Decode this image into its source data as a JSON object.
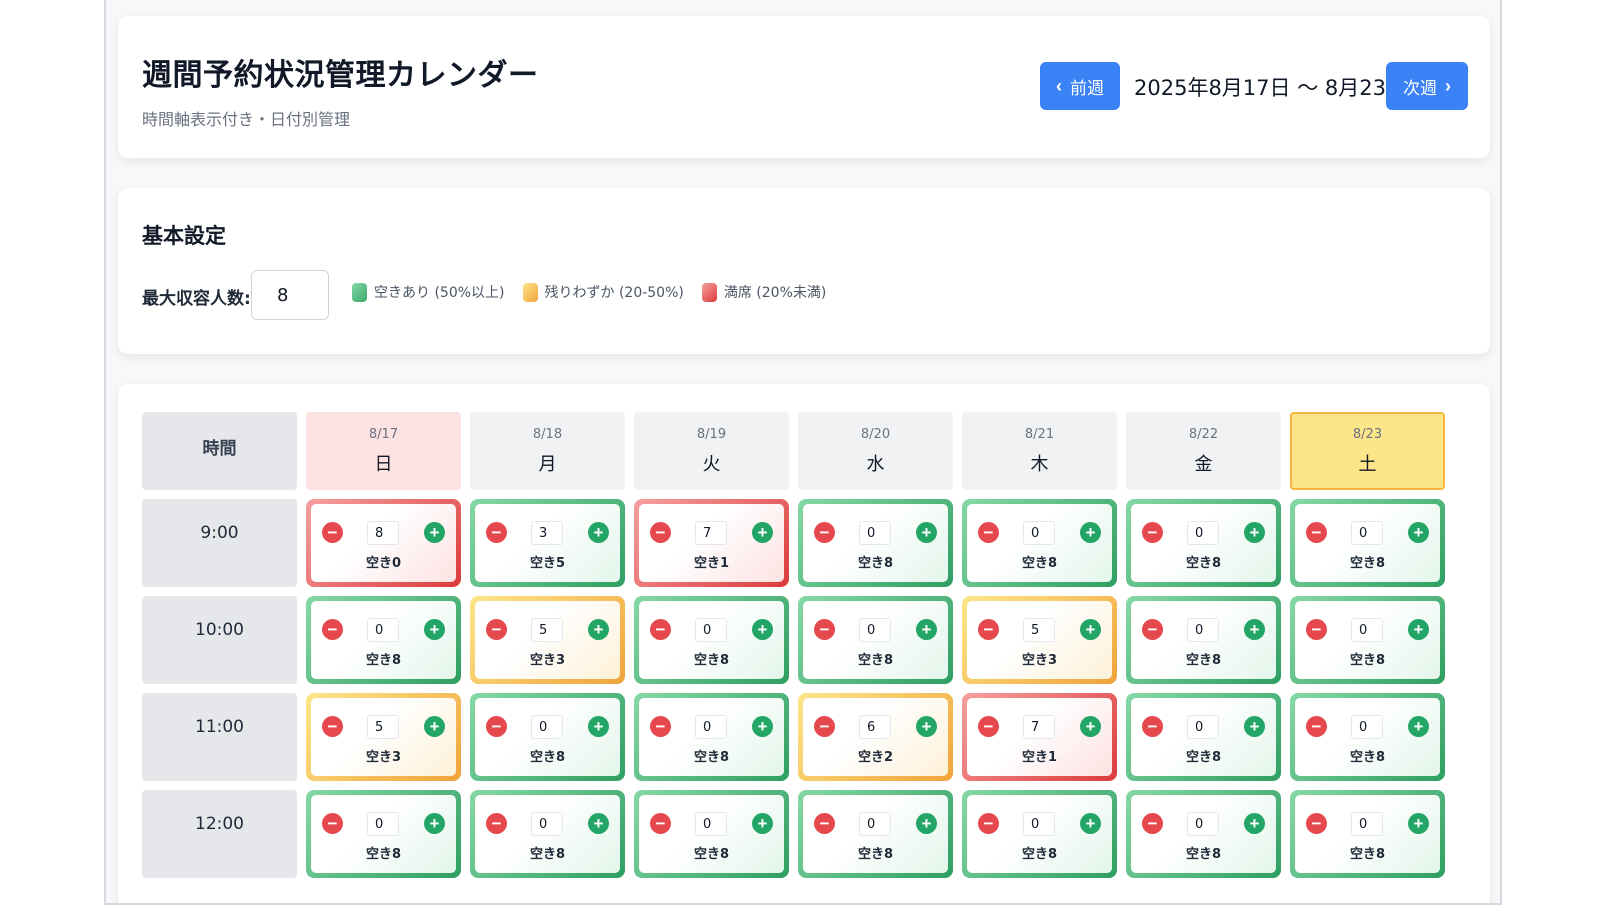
{
  "header": {
    "title": "週間予約状況管理カレンダー",
    "subtitle": "時間軸表示付き・日付別管理",
    "prev_label": "前週",
    "next_label": "次週",
    "week_range": "2025年8月17日 〜 8月23日"
  },
  "settings": {
    "title": "基本設定",
    "capacity_label": "最大収容人数:",
    "capacity_value": "8",
    "legend": [
      {
        "label": "空きあり (50%以上)",
        "color": "#5fcf8c"
      },
      {
        "label": "残りわずか (20-50%)",
        "color": "#f6c044"
      },
      {
        "label": "満席 (20%未満)",
        "color": "#f07272"
      }
    ]
  },
  "calendar": {
    "time_header": "時間",
    "days": [
      {
        "date": "8/17",
        "name": "日",
        "type": "sun"
      },
      {
        "date": "8/18",
        "name": "月",
        "type": ""
      },
      {
        "date": "8/19",
        "name": "火",
        "type": ""
      },
      {
        "date": "8/20",
        "name": "水",
        "type": ""
      },
      {
        "date": "8/21",
        "name": "木",
        "type": ""
      },
      {
        "date": "8/22",
        "name": "金",
        "type": ""
      },
      {
        "date": "8/23",
        "name": "土",
        "type": "sat"
      }
    ],
    "rows": [
      {
        "time": "9:00",
        "slots": [
          {
            "count": "8",
            "label": "空き0",
            "status": "red"
          },
          {
            "count": "3",
            "label": "空き5",
            "status": "green"
          },
          {
            "count": "7",
            "label": "空き1",
            "status": "red"
          },
          {
            "count": "0",
            "label": "空き8",
            "status": "green"
          },
          {
            "count": "0",
            "label": "空き8",
            "status": "green"
          },
          {
            "count": "0",
            "label": "空き8",
            "status": "green"
          },
          {
            "count": "0",
            "label": "空き8",
            "status": "green"
          }
        ]
      },
      {
        "time": "10:00",
        "slots": [
          {
            "count": "0",
            "label": "空き8",
            "status": "green"
          },
          {
            "count": "5",
            "label": "空き3",
            "status": "yellow"
          },
          {
            "count": "0",
            "label": "空き8",
            "status": "green"
          },
          {
            "count": "0",
            "label": "空き8",
            "status": "green"
          },
          {
            "count": "5",
            "label": "空き3",
            "status": "yellow"
          },
          {
            "count": "0",
            "label": "空き8",
            "status": "green"
          },
          {
            "count": "0",
            "label": "空き8",
            "status": "green"
          }
        ]
      },
      {
        "time": "11:00",
        "slots": [
          {
            "count": "5",
            "label": "空き3",
            "status": "yellow"
          },
          {
            "count": "0",
            "label": "空き8",
            "status": "green"
          },
          {
            "count": "0",
            "label": "空き8",
            "status": "green"
          },
          {
            "count": "6",
            "label": "空き2",
            "status": "yellow"
          },
          {
            "count": "7",
            "label": "空き1",
            "status": "red"
          },
          {
            "count": "0",
            "label": "空き8",
            "status": "green"
          },
          {
            "count": "0",
            "label": "空き8",
            "status": "green"
          }
        ]
      },
      {
        "time": "12:00",
        "slots": [
          {
            "count": "0",
            "label": "空き8",
            "status": "green"
          },
          {
            "count": "0",
            "label": "空き8",
            "status": "green"
          },
          {
            "count": "0",
            "label": "空き8",
            "status": "green"
          },
          {
            "count": "0",
            "label": "空き8",
            "status": "green"
          },
          {
            "count": "0",
            "label": "空き8",
            "status": "green"
          },
          {
            "count": "0",
            "label": "空き8",
            "status": "green"
          },
          {
            "count": "0",
            "label": "空き8",
            "status": "green"
          }
        ]
      }
    ]
  },
  "icons": {
    "minus": "minus-circle-icon",
    "plus": "plus-circle-icon",
    "prev": "chevron-left-icon",
    "next": "chevron-right-icon"
  }
}
